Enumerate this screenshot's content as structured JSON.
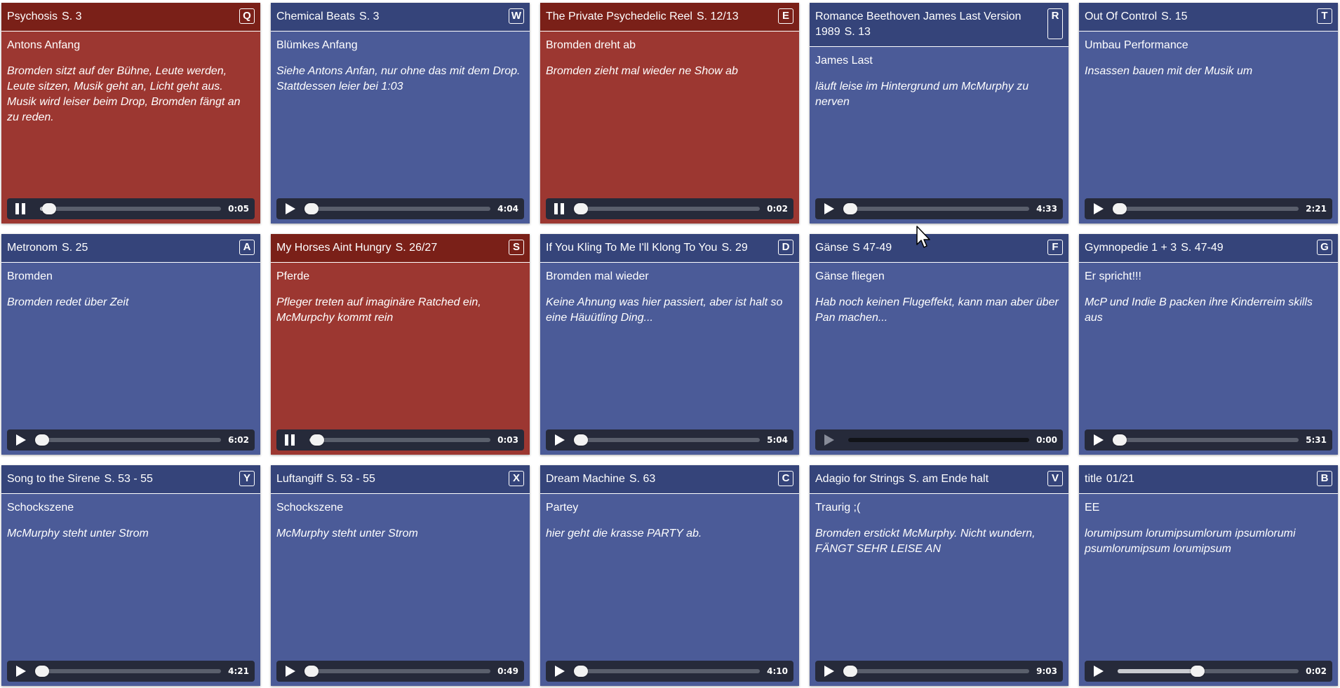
{
  "cards": [
    {
      "title": "Psychosis",
      "page": "S. 3",
      "hotkey": "Q",
      "subtitle": "Antons Anfang",
      "description": "Bromden sitzt auf der Bühne, Leute werden, Leute sitzen, Musik geht an, Licht geht aus. Musik wird leiser beim Drop, Bromden fängt an zu reden.",
      "state": "playing",
      "time": "0:05",
      "progress": 0.04
    },
    {
      "title": "Chemical Beats",
      "page": "S. 3",
      "hotkey": "W",
      "subtitle": "Blümkes Anfang",
      "description": "Siehe Antons Anfan, nur ohne das mit dem Drop. Stattdessen leier bei 1:03",
      "state": "paused",
      "time": "4:04",
      "progress": 0.0
    },
    {
      "title": "The Private Psychedelic Reel",
      "page": "S. 12/13",
      "hotkey": "E",
      "subtitle": "Bromden dreht ab",
      "description": "Bromden zieht mal wieder ne Show ab",
      "state": "playing",
      "time": "0:02",
      "progress": 0.0
    },
    {
      "title": "Romance Beethoven James Last Version 1989",
      "page": "S. 13",
      "hotkey": "R",
      "subtitle": "James Last",
      "description": "läuft leise im Hintergrund um McMurphy zu nerven",
      "state": "paused",
      "time": "4:33",
      "progress": 0.0
    },
    {
      "title": "Out Of Control",
      "page": "S. 15",
      "hotkey": "T",
      "subtitle": "Umbau Performance",
      "description": "Insassen bauen mit der Musik um",
      "state": "paused",
      "time": "2:21",
      "progress": 0.0
    },
    {
      "title": "Metronom",
      "page": "S. 25",
      "hotkey": "A",
      "subtitle": "Bromden",
      "description": "Bromden redet über Zeit",
      "state": "paused",
      "time": "6:02",
      "progress": 0.0
    },
    {
      "title": "My Horses Aint Hungry",
      "page": "S. 26/27",
      "hotkey": "S",
      "subtitle": "Pferde",
      "description": "Pfleger treten auf imaginäre Ratched ein, McMurpchy kommt rein",
      "state": "playing",
      "time": "0:03",
      "progress": 0.03
    },
    {
      "title": "If You Kling To Me I'll Klong To You",
      "page": "S. 29",
      "hotkey": "D",
      "subtitle": "Bromden mal wieder",
      "description": "Keine Ahnung was hier passiert, aber ist halt so eine Häuütling Ding...",
      "state": "paused",
      "time": "5:04",
      "progress": 0.0
    },
    {
      "title": "Gänse",
      "page": "S 47-49",
      "hotkey": "F",
      "subtitle": "Gänse fliegen",
      "description": "Hab noch keinen Flugeffekt, kann man aber über Pan machen...",
      "state": "disabled",
      "time": "0:00",
      "progress": 0.0
    },
    {
      "title": "Gymnopedie 1 + 3",
      "page": "S. 47-49",
      "hotkey": "G",
      "subtitle": "Er spricht!!!",
      "description": "McP und Indie B packen ihre Kinderreim skills aus",
      "state": "paused",
      "time": "5:31",
      "progress": 0.0
    },
    {
      "title": "Song to the Sirene",
      "page": "S. 53 - 55",
      "hotkey": "Y",
      "subtitle": "Schockszene",
      "description": "McMurphy steht unter Strom",
      "state": "paused",
      "time": "4:21",
      "progress": 0.0
    },
    {
      "title": "Luftangiff",
      "page": "S. 53 - 55",
      "hotkey": "X",
      "subtitle": "Schockszene",
      "description": "McMurphy steht unter Strom",
      "state": "paused",
      "time": "0:49",
      "progress": 0.0
    },
    {
      "title": "Dream Machine",
      "page": "S. 63",
      "hotkey": "C",
      "subtitle": "Partey",
      "description": "hier geht die krasse PARTY ab.",
      "state": "paused",
      "time": "4:10",
      "progress": 0.0
    },
    {
      "title": "Adagio for Strings",
      "page": "S. am Ende halt",
      "hotkey": "V",
      "subtitle": "Traurig ;(",
      "description": "Bromden erstickt McMurphy. Nicht wundern, FÄNGT SEHR LEISE AN",
      "state": "paused",
      "time": "9:03",
      "progress": 0.0
    },
    {
      "title": "title",
      "page": "01/21",
      "hotkey": "B",
      "subtitle": "EE",
      "description": "lorumipsum lorumipsumlorum ipsumlorumi psumlorumipsum lorumipsum",
      "state": "paused",
      "time": "0:02",
      "progress": 0.43
    }
  ],
  "colors": {
    "card_idle": "#4b5b98",
    "card_playing": "#9c3731",
    "header_idle": "#35447a",
    "header_playing": "#7a2018",
    "player_bar": "#262a3a"
  }
}
